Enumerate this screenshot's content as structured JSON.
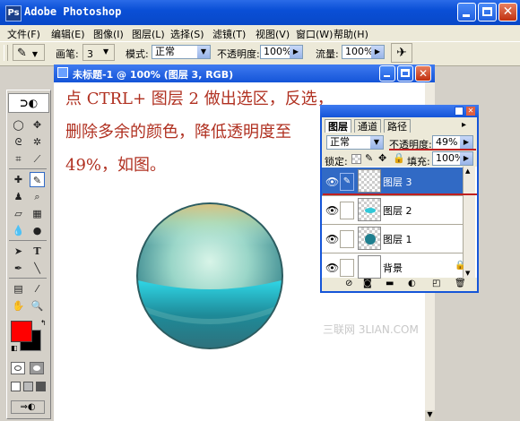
{
  "window": {
    "title": "Adobe Photoshop",
    "app_icon": "Ps"
  },
  "menu": [
    "文件(F)",
    "编辑(E)",
    "图像(I)",
    "图层(L)",
    "选择(S)",
    "滤镜(T)",
    "视图(V)",
    "窗口(W)",
    "帮助(H)"
  ],
  "options": {
    "brush_label": "画笔:",
    "brush_size": "3",
    "mode_label": "模式:",
    "mode_value": "正常",
    "opacity_label": "不透明度:",
    "opacity_value": "100%",
    "flow_label": "流量:",
    "flow_value": "100%"
  },
  "document": {
    "title": "未标题-1 @ 100% (图层 3, RGB)",
    "instruction_line1": "点 CTRL+ 图层 2 做出选区，反选，",
    "instruction_line2": "删除多余的颜色，降低透明度至",
    "instruction_line3": "49%，如图。"
  },
  "layers_panel": {
    "tabs": [
      "图层",
      "通道",
      "路径"
    ],
    "blend_mode": "正常",
    "opacity_label": "不透明度:",
    "opacity_value": "49%",
    "lock_label": "锁定:",
    "fill_label": "填充:",
    "fill_value": "100%",
    "layers": [
      {
        "name": "图层 3",
        "selected": true
      },
      {
        "name": "图层 2",
        "selected": false
      },
      {
        "name": "图层 1",
        "selected": false
      },
      {
        "name": "背景",
        "selected": false
      }
    ]
  },
  "watermark": "三联网 3LIAN.COM",
  "colors": {
    "foreground": "#ff0000",
    "background": "#000000",
    "accent": "#c02020",
    "selection": "#316ac5"
  }
}
